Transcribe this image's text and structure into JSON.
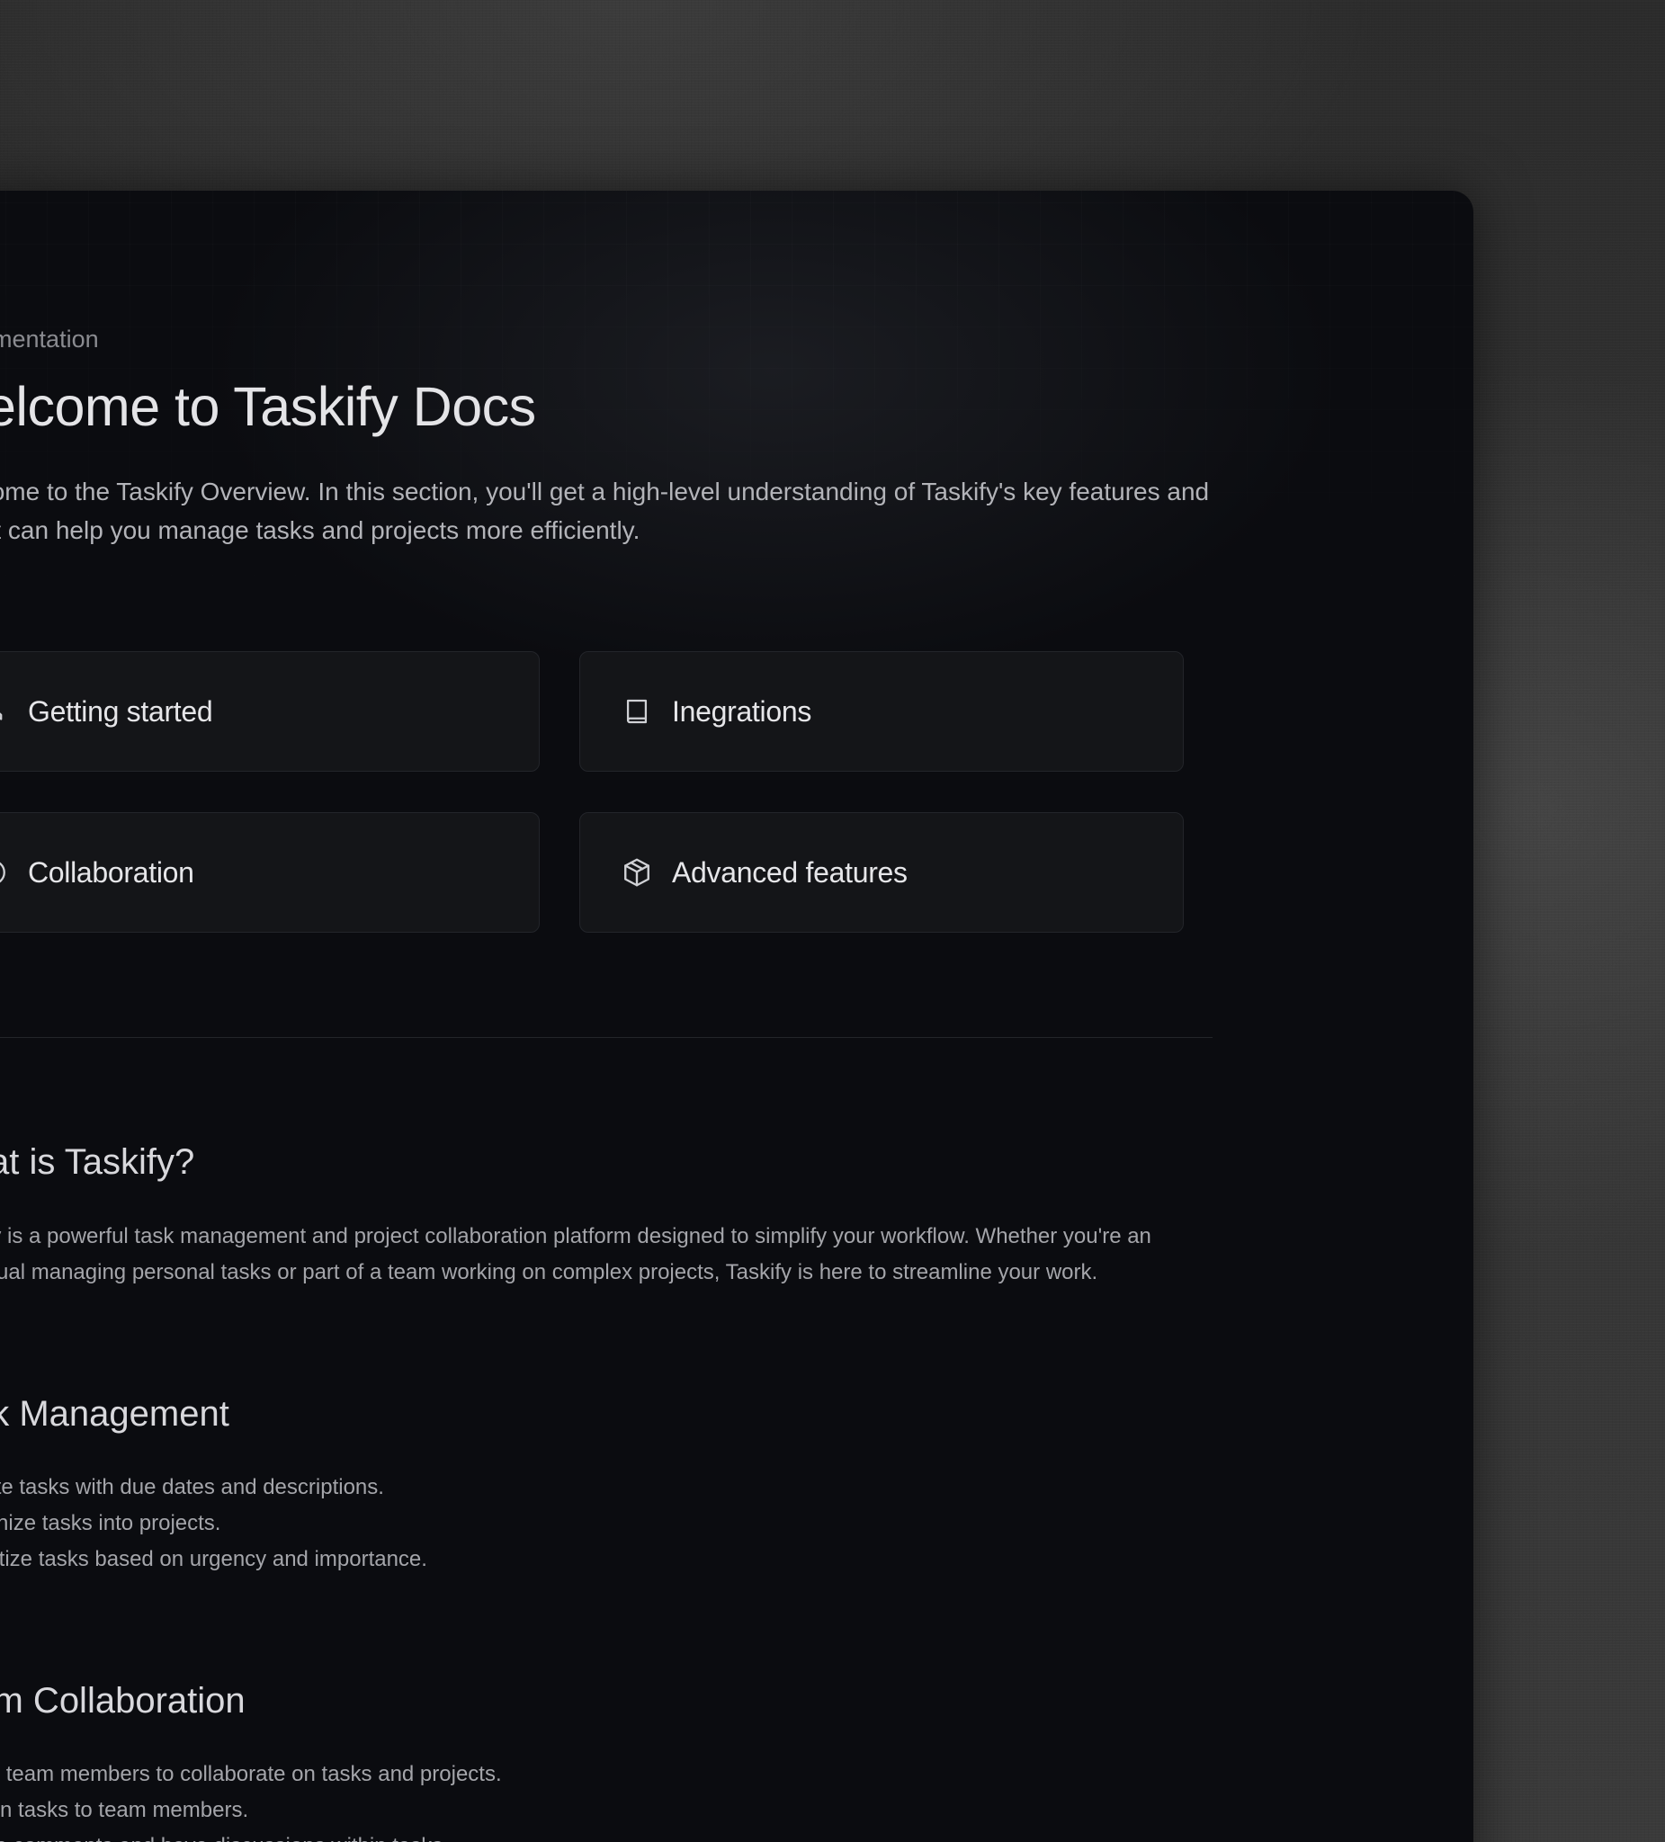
{
  "header": {
    "breadcrumb": "Documentation",
    "title": "Welcome to Taskify Docs",
    "intro": "Welcome to the Taskify Overview. In this section, you'll get a high-level understanding of Taskify's key features and how it can help you manage tasks and projects more efficiently."
  },
  "cards": [
    {
      "label": "Getting started",
      "icon": "rocket-icon"
    },
    {
      "label": "Inegrations",
      "icon": "book-icon"
    },
    {
      "label": "Collaboration",
      "icon": "play-circle-icon"
    },
    {
      "label": "Advanced features",
      "icon": "package-icon"
    }
  ],
  "sections": {
    "what_is": {
      "heading": "What is Taskify?",
      "body": "Taskify is a powerful task management and project collaboration platform designed to simplify your workflow. Whether you're an individual managing personal tasks or part of a team working on complex projects, Taskify is here to streamline your work."
    },
    "task_management": {
      "heading": "Task Management",
      "items": [
        "Create tasks with due dates and descriptions.",
        "Organize tasks into projects.",
        "Prioritize tasks based on urgency and importance."
      ]
    },
    "team_collaboration": {
      "heading": "Team Collaboration",
      "items": [
        "Invite team members to collaborate on tasks and projects.",
        "Assign tasks to team members.",
        "Leave comments and have discussions within tasks."
      ]
    }
  },
  "colors": {
    "window_bg": "#0b0c10",
    "card_bg": "#141518",
    "card_border": "#23252a",
    "text_primary": "#e4e4e7",
    "text_muted": "#a4a5aa"
  }
}
